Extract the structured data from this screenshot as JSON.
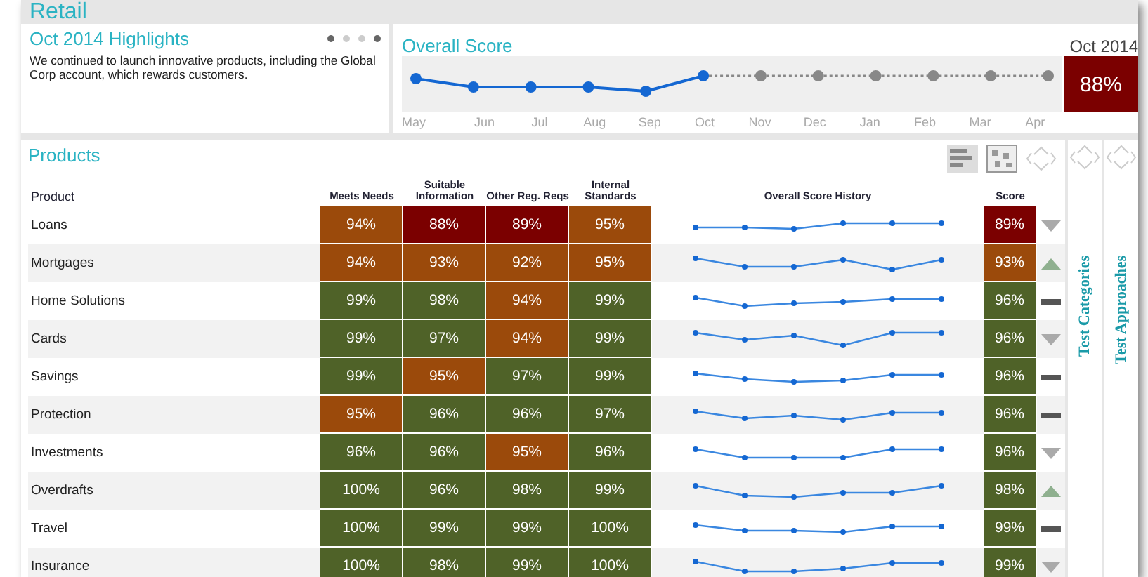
{
  "header": {
    "title": "Retail"
  },
  "highlights": {
    "title": "Oct 2014 Highlights",
    "text": "We continued to launch innovative products, including the Global Corp account, which rewards customers.",
    "dots": [
      {
        "selected": true
      },
      {
        "selected": false
      },
      {
        "selected": false
      },
      {
        "selected": true
      }
    ]
  },
  "overall_score": {
    "title": "Overall Score",
    "period": "Oct 2014",
    "score": "88%",
    "color": "#7b0000",
    "months": [
      {
        "label": "May",
        "reported": true
      },
      {
        "label": "Jun",
        "reported": true
      },
      {
        "label": "Jul",
        "reported": true
      },
      {
        "label": "Aug",
        "reported": true
      },
      {
        "label": "Sep",
        "reported": true
      },
      {
        "label": "Oct",
        "reported": true
      },
      {
        "label": "Nov",
        "reported": false
      },
      {
        "label": "Dec",
        "reported": false
      },
      {
        "label": "Jan",
        "reported": false
      },
      {
        "label": "Feb",
        "reported": false
      },
      {
        "label": "Mar",
        "reported": false
      },
      {
        "label": "Apr",
        "reported": false
      }
    ]
  },
  "products": {
    "title": "Products",
    "columns": [
      "Product",
      "Meets Needs",
      "Suitable Information",
      "Other Reg. Reqs",
      "Internal Standards",
      "Overall Score History",
      "Score"
    ],
    "rows": [
      {
        "cells": [
          {
            "text": "Loans"
          },
          {
            "text": "94%",
            "color": "#9b4a0b"
          },
          {
            "text": "88%",
            "color": "#7b0000"
          },
          {
            "text": "89%",
            "color": "#7b0000"
          },
          {
            "text": "95%",
            "color": "#9b4a0b"
          },
          {
            "kind": "sparkline"
          },
          {
            "text": "89%",
            "color": "#7b0000"
          }
        ],
        "kind": "down"
      },
      {
        "cells": [
          {
            "text": "Mortgages"
          },
          {
            "text": "94%",
            "color": "#9b4a0b"
          },
          {
            "text": "93%",
            "color": "#9b4a0b"
          },
          {
            "text": "92%",
            "color": "#9b4a0b"
          },
          {
            "text": "95%",
            "color": "#9b4a0b"
          },
          {
            "kind": "sparkline"
          },
          {
            "text": "93%",
            "color": "#9b4a0b"
          }
        ],
        "kind": "up"
      },
      {
        "cells": [
          {
            "text": "Home Solutions"
          },
          {
            "text": "99%",
            "color": "#4f6228"
          },
          {
            "text": "98%",
            "color": "#4f6228"
          },
          {
            "text": "94%",
            "color": "#9b4a0b"
          },
          {
            "text": "99%",
            "color": "#4f6228"
          },
          {
            "kind": "sparkline"
          },
          {
            "text": "96%",
            "color": "#4f6228"
          }
        ],
        "kind": "flat"
      },
      {
        "cells": [
          {
            "text": "Cards"
          },
          {
            "text": "99%",
            "color": "#4f6228"
          },
          {
            "text": "97%",
            "color": "#4f6228"
          },
          {
            "text": "94%",
            "color": "#9b4a0b"
          },
          {
            "text": "99%",
            "color": "#4f6228"
          },
          {
            "kind": "sparkline"
          },
          {
            "text": "96%",
            "color": "#4f6228"
          }
        ],
        "kind": "down"
      },
      {
        "cells": [
          {
            "text": "Savings"
          },
          {
            "text": "99%",
            "color": "#4f6228"
          },
          {
            "text": "95%",
            "color": "#9b4a0b"
          },
          {
            "text": "97%",
            "color": "#4f6228"
          },
          {
            "text": "99%",
            "color": "#4f6228"
          },
          {
            "kind": "sparkline"
          },
          {
            "text": "96%",
            "color": "#4f6228"
          }
        ],
        "kind": "flat"
      },
      {
        "cells": [
          {
            "text": "Protection"
          },
          {
            "text": "95%",
            "color": "#9b4a0b"
          },
          {
            "text": "96%",
            "color": "#4f6228"
          },
          {
            "text": "96%",
            "color": "#4f6228"
          },
          {
            "text": "97%",
            "color": "#4f6228"
          },
          {
            "kind": "sparkline"
          },
          {
            "text": "96%",
            "color": "#4f6228"
          }
        ],
        "kind": "flat"
      },
      {
        "cells": [
          {
            "text": "Investments"
          },
          {
            "text": "96%",
            "color": "#4f6228"
          },
          {
            "text": "96%",
            "color": "#4f6228"
          },
          {
            "text": "95%",
            "color": "#9b4a0b"
          },
          {
            "text": "96%",
            "color": "#4f6228"
          },
          {
            "kind": "sparkline"
          },
          {
            "text": "96%",
            "color": "#4f6228"
          }
        ],
        "kind": "down"
      },
      {
        "cells": [
          {
            "text": "Overdrafts"
          },
          {
            "text": "100%",
            "color": "#4f6228"
          },
          {
            "text": "96%",
            "color": "#4f6228"
          },
          {
            "text": "98%",
            "color": "#4f6228"
          },
          {
            "text": "99%",
            "color": "#4f6228"
          },
          {
            "kind": "sparkline"
          },
          {
            "text": "98%",
            "color": "#4f6228"
          }
        ],
        "kind": "up"
      },
      {
        "cells": [
          {
            "text": "Travel"
          },
          {
            "text": "100%",
            "color": "#4f6228"
          },
          {
            "text": "99%",
            "color": "#4f6228"
          },
          {
            "text": "99%",
            "color": "#4f6228"
          },
          {
            "text": "100%",
            "color": "#4f6228"
          },
          {
            "kind": "sparkline"
          },
          {
            "text": "99%",
            "color": "#4f6228"
          }
        ],
        "kind": "flat"
      },
      {
        "cells": [
          {
            "text": "Insurance"
          },
          {
            "text": "100%",
            "color": "#4f6228"
          },
          {
            "text": "98%",
            "color": "#4f6228"
          },
          {
            "text": "99%",
            "color": "#4f6228"
          },
          {
            "text": "100%",
            "color": "#4f6228"
          },
          {
            "kind": "sparkline"
          },
          {
            "text": "99%",
            "color": "#4f6228"
          }
        ],
        "kind": "down"
      }
    ]
  },
  "side_tabs": [
    {
      "label": "Test Categories"
    },
    {
      "label": "Test Approaches"
    }
  ]
}
